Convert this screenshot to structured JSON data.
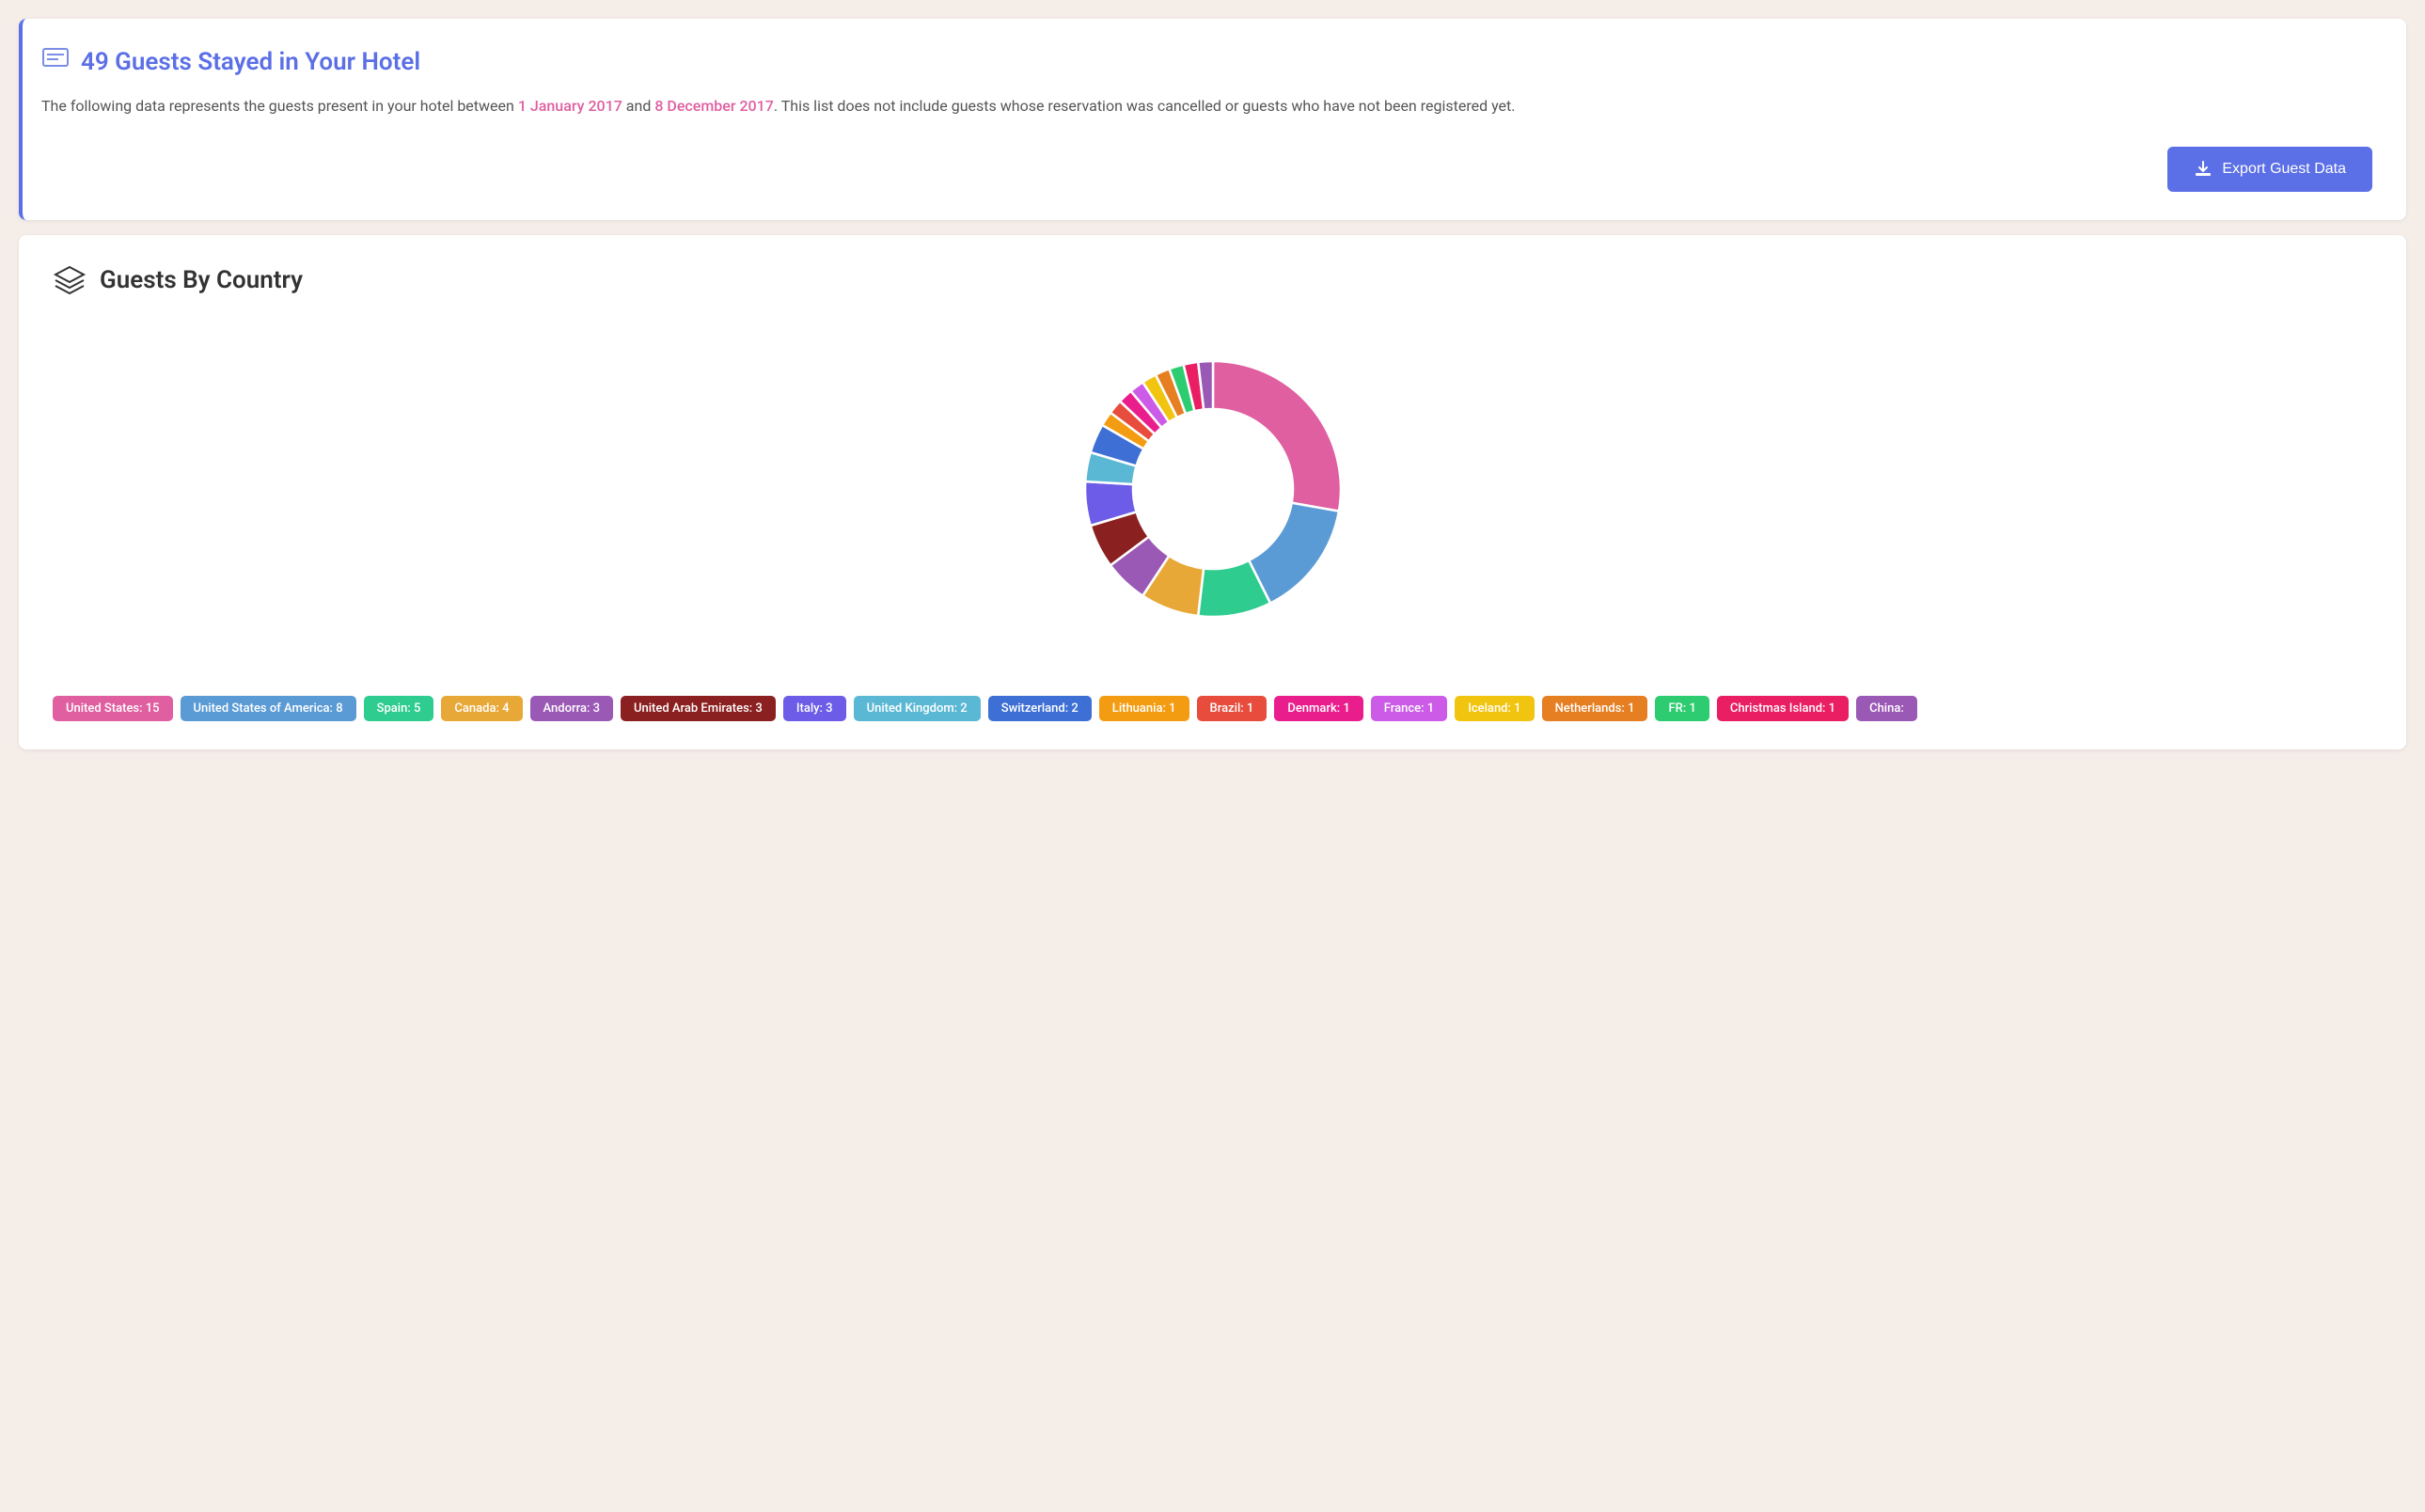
{
  "header": {
    "icon": "📋",
    "title": "49 Guests Stayed in Your Hotel",
    "description_before": "The following data represents the guests present in your hotel between ",
    "date_start": "1 January 2017",
    "description_mid": " and ",
    "date_end": "8 December 2017",
    "description_after": ". This list does not include guests whose reservation was cancelled or guests who have not been registered yet.",
    "export_button": "Export Guest Data"
  },
  "country_section": {
    "title": "Guests By Country"
  },
  "chart": {
    "segments": [
      {
        "country": "United States",
        "value": 15,
        "color": "#e05fa0",
        "percent": 30.6
      },
      {
        "country": "United States of America",
        "value": 8,
        "color": "#5b9bd5",
        "percent": 16.3
      },
      {
        "country": "Spain",
        "value": 5,
        "color": "#2ecc8f",
        "percent": 10.2
      },
      {
        "country": "Canada",
        "value": 4,
        "color": "#e8a838",
        "percent": 8.2
      },
      {
        "country": "Andorra",
        "value": 3,
        "color": "#9b59b6",
        "percent": 6.1
      },
      {
        "country": "United Arab Emirates",
        "value": 3,
        "color": "#8b2020",
        "percent": 6.1
      },
      {
        "country": "Italy",
        "value": 3,
        "color": "#6c5ce7",
        "percent": 6.1
      },
      {
        "country": "United Kingdom",
        "value": 2,
        "color": "#5bb8d4",
        "percent": 4.1
      },
      {
        "country": "Switzerland",
        "value": 2,
        "color": "#3d6fd4",
        "percent": 4.1
      },
      {
        "country": "Lithuania",
        "value": 1,
        "color": "#f39c12",
        "percent": 2.0
      },
      {
        "country": "Brazil",
        "value": 1,
        "color": "#e74c3c",
        "percent": 2.0
      },
      {
        "country": "Denmark",
        "value": 1,
        "color": "#e91e8c",
        "percent": 2.0
      },
      {
        "country": "France",
        "value": 1,
        "color": "#cc5ce7",
        "percent": 2.0
      },
      {
        "country": "Iceland",
        "value": 1,
        "color": "#f1c40f",
        "percent": 2.0
      },
      {
        "country": "Netherlands",
        "value": 1,
        "color": "#e67e22",
        "percent": 2.0
      },
      {
        "country": "FR",
        "value": 1,
        "color": "#2ecc71",
        "percent": 2.0
      },
      {
        "country": "Christmas Island",
        "value": 1,
        "color": "#e91e63",
        "percent": 2.0
      },
      {
        "country": "China",
        "value": 1,
        "color": "#9b59b6",
        "percent": 2.0
      }
    ]
  },
  "legend": [
    {
      "label": "United States: 15",
      "color": "#e05fa0"
    },
    {
      "label": "United States of America: 8",
      "color": "#5b9bd5"
    },
    {
      "label": "Spain: 5",
      "color": "#2ecc8f"
    },
    {
      "label": "Canada: 4",
      "color": "#e8a838"
    },
    {
      "label": "Andorra: 3",
      "color": "#9b59b6"
    },
    {
      "label": "United Arab Emirates: 3",
      "color": "#8b2020"
    },
    {
      "label": "Italy: 3",
      "color": "#6c5ce7"
    },
    {
      "label": "United Kingdom: 2",
      "color": "#5bb8d4"
    },
    {
      "label": "Switzerland: 2",
      "color": "#3d6fd4"
    },
    {
      "label": "Lithuania: 1",
      "color": "#f39c12"
    },
    {
      "label": "Brazil: 1",
      "color": "#e74c3c"
    },
    {
      "label": "Denmark: 1",
      "color": "#e91e8c"
    },
    {
      "label": "France: 1",
      "color": "#cc5ce7"
    },
    {
      "label": "Iceland: 1",
      "color": "#f1c40f"
    },
    {
      "label": "Netherlands: 1",
      "color": "#e67e22"
    },
    {
      "label": "FR: 1",
      "color": "#2ecc71"
    },
    {
      "label": "Christmas Island: 1",
      "color": "#e91e63"
    },
    {
      "label": "China:",
      "color": "#9b59b6"
    }
  ]
}
